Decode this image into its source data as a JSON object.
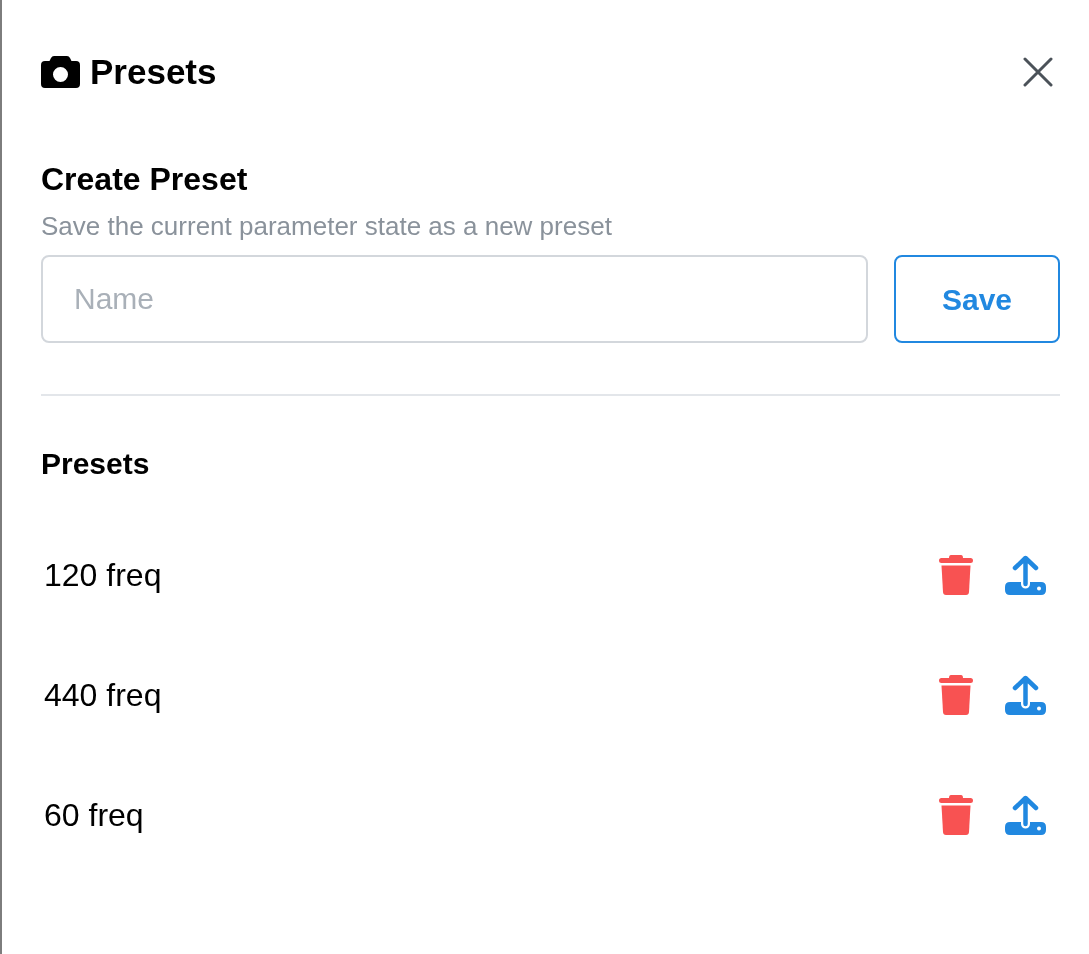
{
  "header": {
    "title": "Presets"
  },
  "create": {
    "title": "Create Preset",
    "description": "Save the current parameter state as a new preset",
    "name_field": {
      "placeholder": "Name"
    },
    "save_button": "Save"
  },
  "presets": {
    "title": "Presets",
    "items": [
      {
        "name": "120 freq"
      },
      {
        "name": "440 freq"
      },
      {
        "name": "60 freq"
      }
    ]
  }
}
